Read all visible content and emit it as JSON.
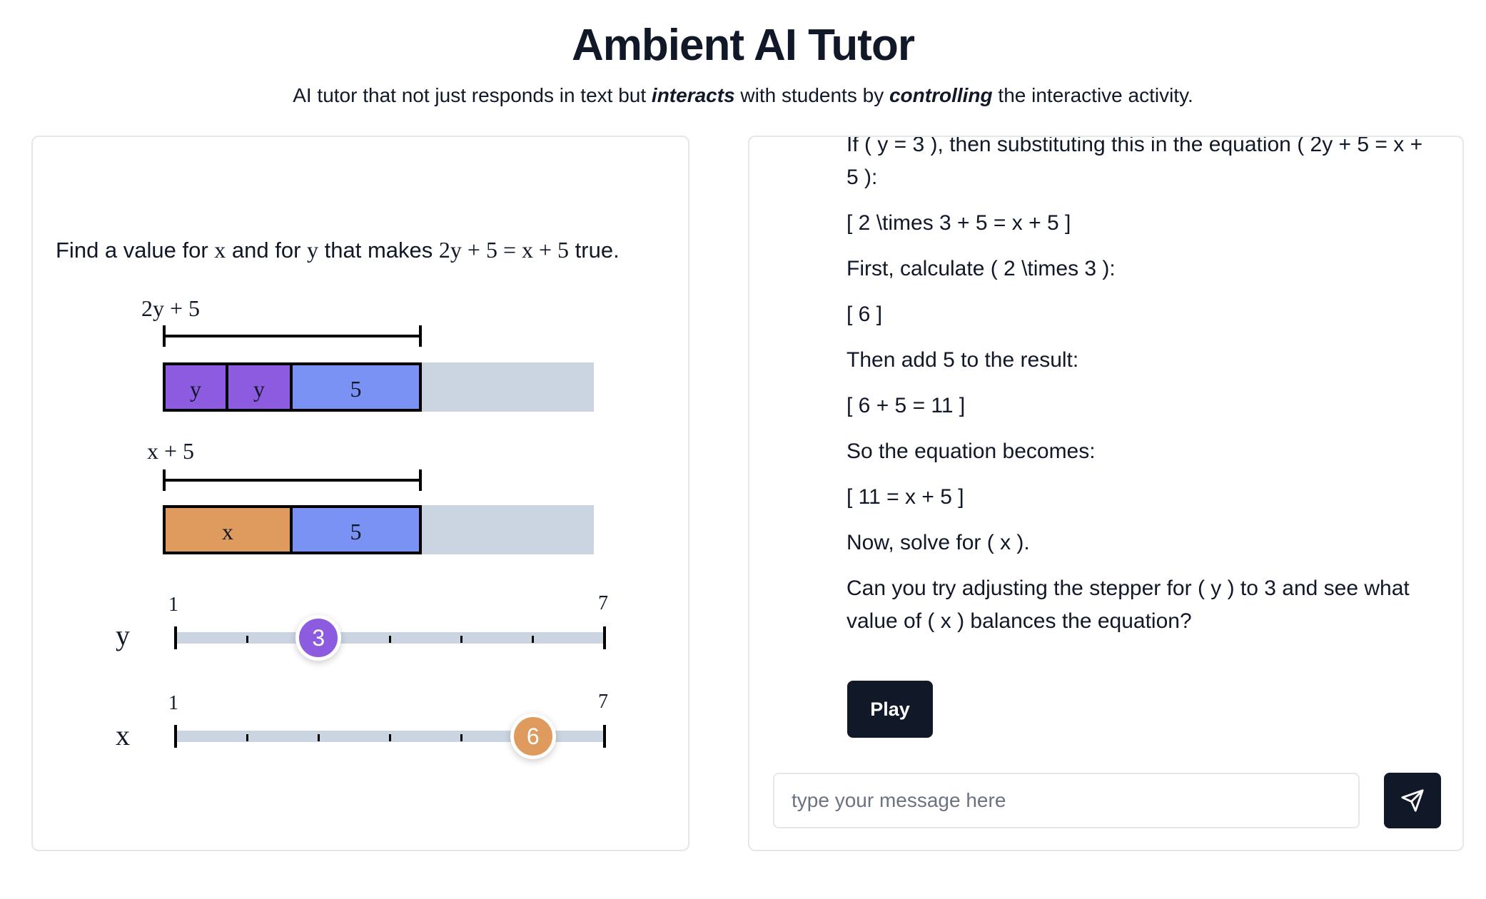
{
  "header": {
    "title": "Ambient AI Tutor",
    "subtitle_parts": [
      "AI tutor that not just responds in text but ",
      "interacts",
      " with students by ",
      "controlling",
      " the interactive activity."
    ]
  },
  "activity": {
    "question_parts": [
      "Find a value for ",
      "x",
      " and for ",
      "y",
      " that makes ",
      "2y + 5 = x + 5",
      " true."
    ],
    "top_bar": {
      "label": "2y + 5",
      "segments": [
        "y",
        "y",
        "5"
      ]
    },
    "bottom_bar": {
      "label": "x + 5",
      "segments": [
        "x",
        "5"
      ]
    },
    "colors": {
      "y": "#8d5be0",
      "x": "#df9a5e",
      "constant": "#7b92f5",
      "track": "#cbd5e1"
    },
    "steppers": [
      {
        "variable": "y",
        "min": "1",
        "max": "7",
        "value": "3"
      },
      {
        "variable": "x",
        "min": "1",
        "max": "7",
        "value": "6"
      }
    ]
  },
  "chat": {
    "messages": [
      "If ( y = 3 ), then substituting this in the equation ( 2y + 5 = x + 5 ):",
      "[ 2 \\times 3 + 5 = x + 5 ]",
      "First, calculate ( 2 \\times 3 ):",
      "[ 6 ]",
      "Then add 5 to the result:",
      "[ 6 + 5 = 11 ]",
      "So the equation becomes:",
      "[ 11 = x + 5 ]",
      "Now, solve for ( x ).",
      "Can you try adjusting the stepper for ( y ) to 3 and see what value of ( x ) balances the equation?"
    ],
    "play_label": "Play",
    "input_placeholder": "type your message here",
    "input_value": "",
    "send_icon": "send-icon"
  }
}
